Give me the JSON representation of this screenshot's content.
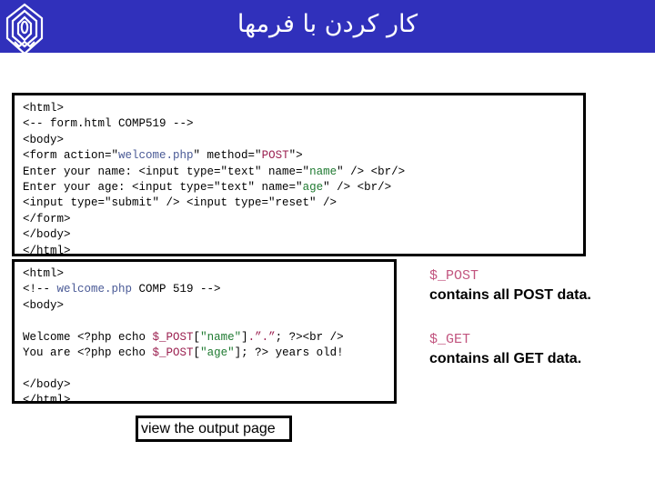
{
  "header": {
    "title": "کار کردن با فرمها",
    "logo_name": "university-emblem-logo",
    "background_color": "#3030bb",
    "title_color": "#ffffff"
  },
  "code_blocks": [
    {
      "id": "form-html",
      "lines": [
        [
          {
            "t": "<html>",
            "c": "plain"
          }
        ],
        [
          {
            "t": "<-- form.html COMP519 -->",
            "c": "plain"
          }
        ],
        [
          {
            "t": "<body>",
            "c": "plain"
          }
        ],
        [
          {
            "t": "<form action=\"",
            "c": "plain"
          },
          {
            "t": "welcome.php",
            "c": "str-blue"
          },
          {
            "t": "\" method=\"",
            "c": "plain"
          },
          {
            "t": "POST",
            "c": "kw-red"
          },
          {
            "t": "\">",
            "c": "plain"
          }
        ],
        [
          {
            "t": "Enter your name: <input type=\"text\" name=\"",
            "c": "plain"
          },
          {
            "t": "name",
            "c": "str-green"
          },
          {
            "t": "\" /> <br/>",
            "c": "plain"
          }
        ],
        [
          {
            "t": "Enter your age: <input type=\"text\" name=\"",
            "c": "plain"
          },
          {
            "t": "age",
            "c": "str-green"
          },
          {
            "t": "\" /> <br/>",
            "c": "plain"
          }
        ],
        [
          {
            "t": "<input type=\"submit\" /> <input type=\"reset\" />",
            "c": "plain"
          }
        ],
        [
          {
            "t": "</form>",
            "c": "plain"
          }
        ],
        [
          {
            "t": "</body>",
            "c": "plain"
          }
        ],
        [
          {
            "t": "</html>",
            "c": "plain"
          }
        ]
      ]
    },
    {
      "id": "welcome-php",
      "lines": [
        [
          {
            "t": "<html>",
            "c": "plain"
          }
        ],
        [
          {
            "t": "<!-- ",
            "c": "plain"
          },
          {
            "t": "welcome.php",
            "c": "str-blue"
          },
          {
            "t": " COMP 519 -->",
            "c": "plain"
          }
        ],
        [
          {
            "t": "<body>",
            "c": "plain"
          }
        ],
        [
          {
            "t": "",
            "c": "blank"
          }
        ],
        [
          {
            "t": "Welcome <?php echo ",
            "c": "plain"
          },
          {
            "t": "$_POST",
            "c": "var-red"
          },
          {
            "t": "[",
            "c": "plain"
          },
          {
            "t": "\"name\"",
            "c": "str-green"
          },
          {
            "t": "]",
            "c": "plain"
          },
          {
            "t": ".”.”",
            "c": "q-red"
          },
          {
            "t": "; ?><br />",
            "c": "plain"
          }
        ],
        [
          {
            "t": "You are <?php echo ",
            "c": "plain"
          },
          {
            "t": "$_POST",
            "c": "var-red"
          },
          {
            "t": "[",
            "c": "plain"
          },
          {
            "t": "\"age\"",
            "c": "str-green"
          },
          {
            "t": "]; ?> years old!",
            "c": "plain"
          }
        ],
        [
          {
            "t": "",
            "c": "blank"
          }
        ],
        [
          {
            "t": "</body>",
            "c": "plain"
          }
        ],
        [
          {
            "t": "</html>",
            "c": "plain"
          }
        ]
      ]
    }
  ],
  "notes": {
    "post_var": "$_POST",
    "post_desc": "contains all POST data.",
    "get_var": "$_GET",
    "get_desc": "contains all GET data.",
    "var_color": "#c2557f"
  },
  "caption": {
    "text": "view the output page"
  }
}
